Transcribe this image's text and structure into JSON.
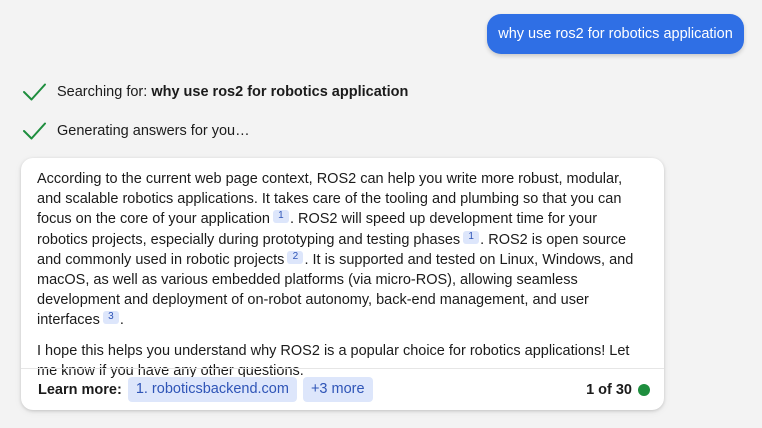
{
  "user_message": "why use ros2 for robotics application",
  "progress": [
    {
      "prefix": "Searching for:",
      "query": "why use ros2 for robotics application",
      "icon": "check-icon"
    },
    {
      "prefix": "Generating answers for you…",
      "icon": "check-icon"
    }
  ],
  "answer": {
    "p1": {
      "s1": "According to the current web page context, ROS2 can help you write more robust, modular, and scalable robotics applications. It takes care of the tooling and plumbing so that you can focus on the core of your application",
      "c1": "1",
      "s2": ". ROS2 will speed up development time for your robotics projects, especially during prototyping and testing phases",
      "c2": "1",
      "s3": ". ROS2 is open source and commonly used in robotic projects",
      "c3": "2",
      "s4": ". It is supported and tested on Linux, Windows, and macOS, as well as various embedded platforms (via micro-ROS), allowing seamless development and deployment of on-robot autonomy, back-end management, and user interfaces",
      "c4": "3",
      "s5": "."
    },
    "p2": "I hope this helps you understand why ROS2 is a popular choice for robotics applications! Let me know if you have any other questions."
  },
  "footer": {
    "learn_more_label": "Learn more:",
    "source_link": "1. roboticsbackend.com",
    "more_link": "+3 more",
    "turn_count": "1 of 30",
    "status_color": "#1e8e3e"
  },
  "colors": {
    "accent": "#2f6fe5",
    "check": "#1e8e3e",
    "chip_bg": "#dde6fb",
    "chip_text": "#2f55b7"
  }
}
